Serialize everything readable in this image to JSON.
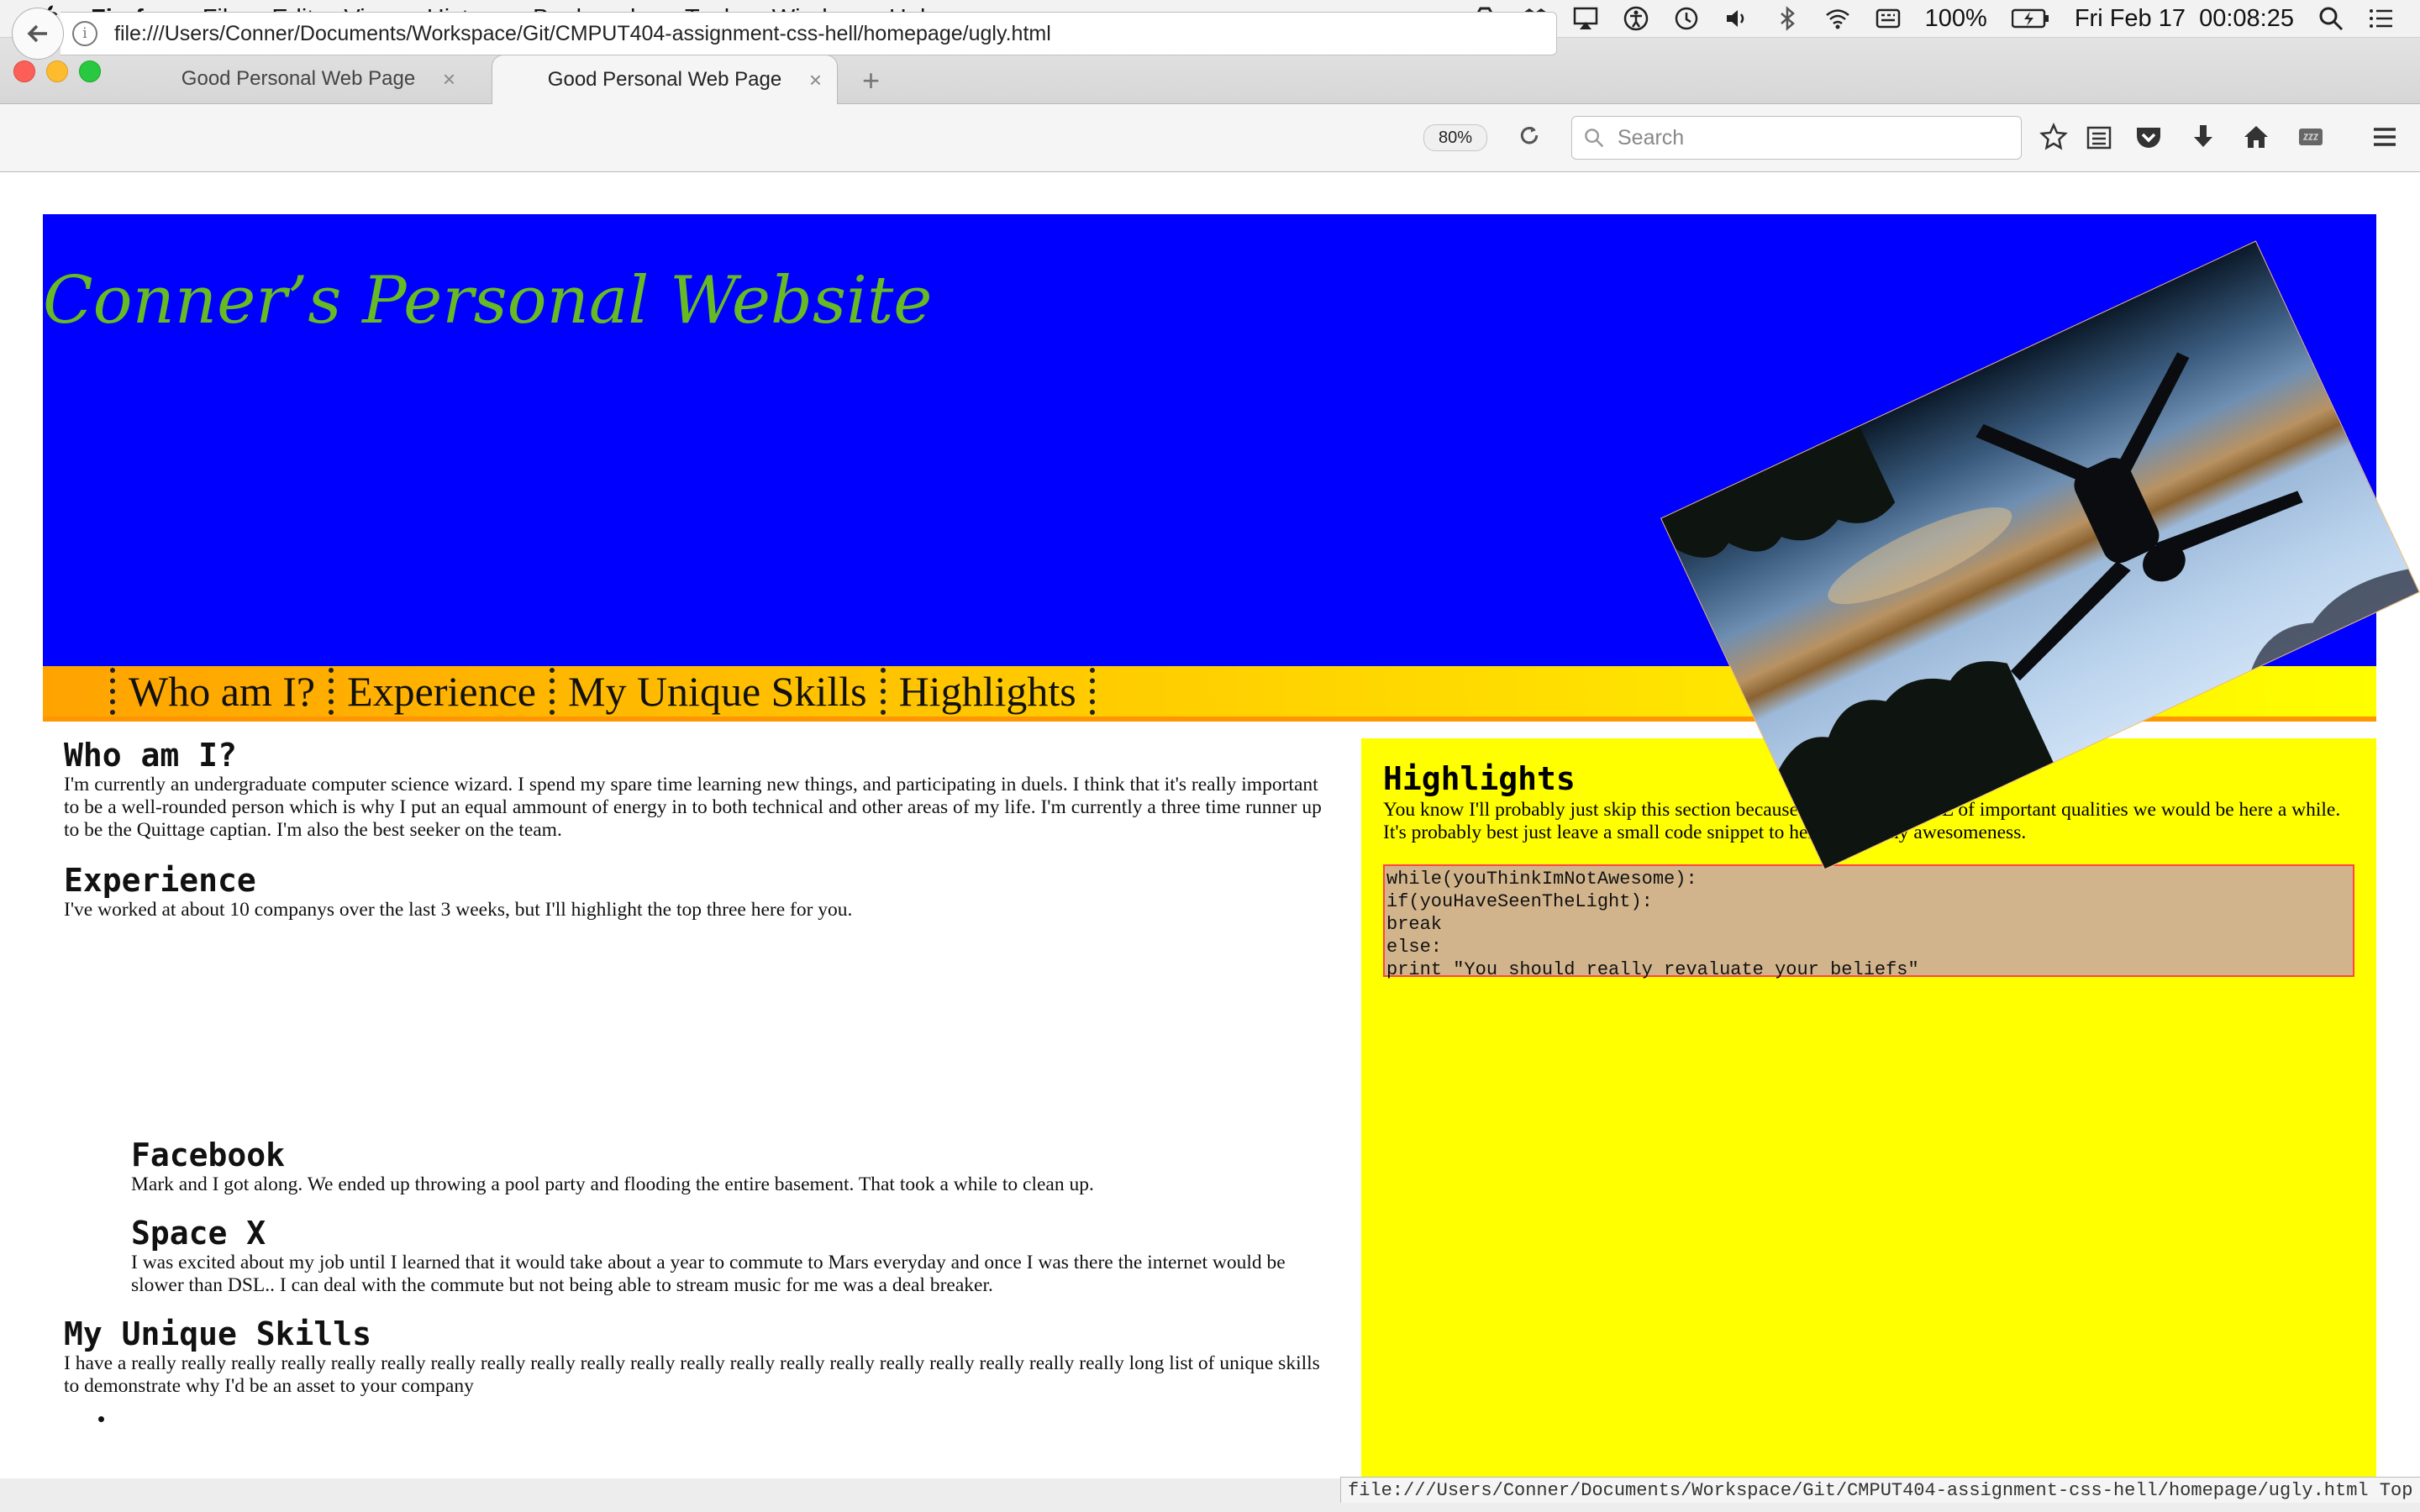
{
  "menubar": {
    "app_name": "Firefox",
    "menus": [
      "File",
      "Edit",
      "View",
      "History",
      "Bookmarks",
      "Tools",
      "Window",
      "Help"
    ],
    "battery": "100%",
    "clock": "Fri Feb 17  00:08:25"
  },
  "tabs": [
    {
      "title": "Good Personal Web Page",
      "active": false
    },
    {
      "title": "Good Personal Web Page",
      "active": true
    }
  ],
  "navbar": {
    "url": "file:///Users/Conner/Documents/Workspace/Git/CMPUT404-assignment-css-hell/homepage/ugly.html",
    "zoom": "80%",
    "search_placeholder": "Search"
  },
  "page": {
    "site_title": "Conner’s Personal Website",
    "nav": [
      "Who am I?",
      "Experience",
      "My Unique Skills",
      "Highlights"
    ],
    "who": {
      "heading": "Who am I?",
      "text": "I'm currently an undergraduate computer science wizard. I spend my spare time learning new things, and participating in duels. I think that it's really important to be a well-rounded person which is why I put an equal ammount of energy in to both technical and other areas of my life. I'm currently a three time runner up to be the Quittage captian. I'm also the best seeker on the team."
    },
    "experience": {
      "heading": "Experience",
      "text": "I've worked at about 10 companys over the last 3 weeks, but I'll highlight the top three here for you.",
      "jobs": [
        {
          "name": "Facebook",
          "text": "Mark and I got along. We ended up throwing a pool party and flooding the entire basement. That took a while to clean up."
        },
        {
          "name": "Space X",
          "text": "I was excited about my job until I learned that it would take about a year to commute to Mars everyday and once I was there the internet would be slower than DSL.. I can deal with the commute but not being able to stream music for me was a deal breaker."
        }
      ]
    },
    "skills": {
      "heading": "My Unique Skills",
      "text": "I have a really really really really really really really really really really really really really really really really really really really really long list of unique skills to demonstrate why I'd be an asset to your company"
    },
    "highlights": {
      "heading": "Highlights",
      "text": "You know I'll probably just skip this section because if I was to list ALL of important qualities we would be here a while. It's probably best just leave a small code snippet to help justify my awesomeness.",
      "code": [
        "while(youThinkImNotAwesome):",
        "if(youHaveSeenTheLight):",
        "break",
        "else:",
        "print \"You should really revaluate your beliefs\""
      ]
    }
  },
  "statusbar": {
    "url": "file:///Users/Conner/Documents/Workspace/Git/CMPUT404-assignment-css-hell/homepage/ugly.html Top"
  },
  "colors": {
    "header_blue": "#0000fe",
    "title_green": "#66bb22",
    "aside_yellow": "#ffff00",
    "code_bg": "#d2b48c",
    "code_border": "#ff4444"
  }
}
